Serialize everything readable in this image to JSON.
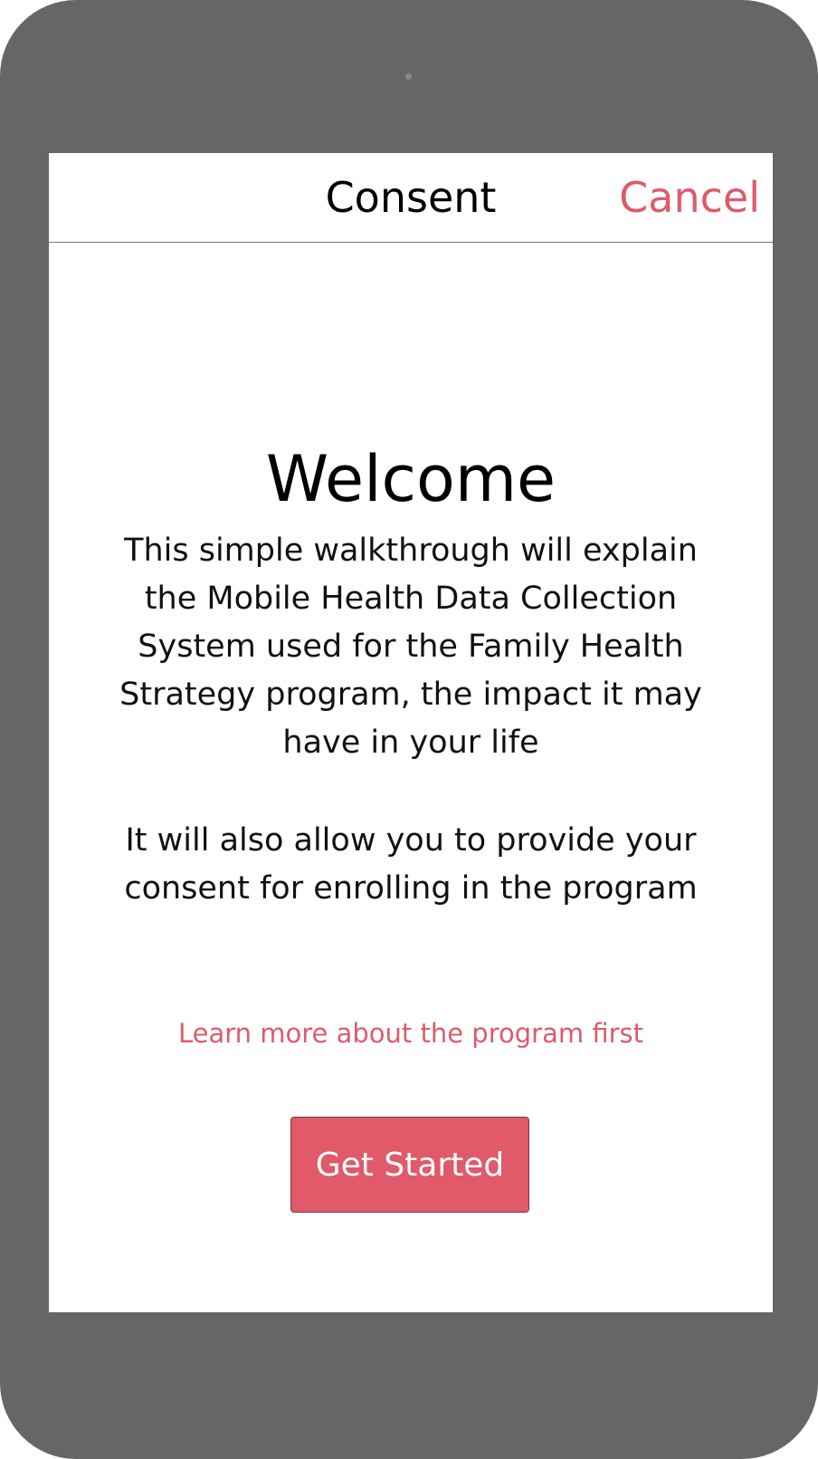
{
  "nav": {
    "title": "Consent",
    "cancel_label": "Cancel"
  },
  "content": {
    "welcome_title": "Welcome",
    "intro_text": "This simple walkthrough will explain the Mobile Health Data Collection System used for the Family Health Strategy program, the impact it may have in your life",
    "consent_text": "It will also allow you to provide your consent for enrolling in the program",
    "learn_more_label": "Learn more about the program first",
    "get_started_label": "Get Started"
  },
  "colors": {
    "accent": "#de5b6b",
    "device_frame": "#666666",
    "button_bg": "#e05a6a"
  }
}
